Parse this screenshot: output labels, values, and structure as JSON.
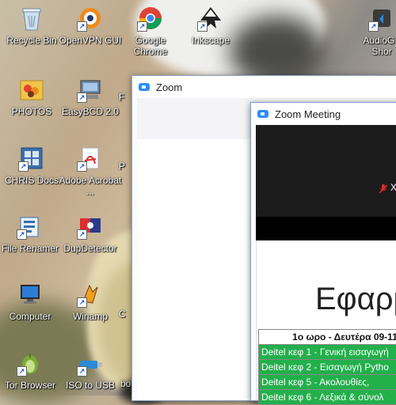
{
  "desktop": {
    "icons": [
      {
        "label": "Recycle Bin",
        "icon": "recycle-bin-icon"
      },
      {
        "label": "OpenVPN GUI",
        "icon": "openvpn-icon"
      },
      {
        "label": "Google Chrome",
        "icon": "chrome-icon"
      },
      {
        "label": "Inkscape",
        "icon": "inkscape-icon"
      },
      {
        "label": "AudioG - Shor",
        "icon": "audio-icon"
      },
      {
        "label": "PHOTOS",
        "icon": "photos-folder-icon"
      },
      {
        "label": "EasyBCD 2.0",
        "icon": "easybcd-icon"
      },
      {
        "label": "CHRIS Docs",
        "icon": "docs-folder-icon"
      },
      {
        "label": "Adobe Acrobat ...",
        "icon": "acrobat-icon"
      },
      {
        "label": "File Renamer",
        "icon": "file-renamer-icon"
      },
      {
        "label": "DupDetector",
        "icon": "dupdetector-icon"
      },
      {
        "label": "Computer",
        "icon": "computer-icon"
      },
      {
        "label": "Winamp",
        "icon": "winamp-icon"
      },
      {
        "label": "Tor Browser",
        "icon": "tor-browser-icon"
      },
      {
        "label": "ISO to USB",
        "icon": "iso-to-usb-icon"
      },
      {
        "label": "F",
        "icon": "partial-icon"
      },
      {
        "label": "P",
        "icon": "partial-icon"
      },
      {
        "label": "C",
        "icon": "partial-icon"
      },
      {
        "label": "bo",
        "icon": "partial-icon"
      }
    ]
  },
  "zoom_window": {
    "title": "Zoom"
  },
  "meeting_window": {
    "title": "Zoom Meeting",
    "participant_initial": "X",
    "slide_title": "Εφαρμ",
    "table_header": "1ο ωρο - Δευτέρα 09-11",
    "rows": [
      "Deitel κεφ 1 - Γενική εισαγωγή",
      "Deitel κεφ 2 - Εισαγωγή Pytho",
      "Deitel κεφ 5 - Ακολουθίες,",
      "Deitel κεφ 6 - Λεξικά & σύνολ"
    ]
  },
  "colors": {
    "zoom_blue": "#2d8cff",
    "table_green": "#22b04b",
    "mute_red": "#d9302c"
  }
}
